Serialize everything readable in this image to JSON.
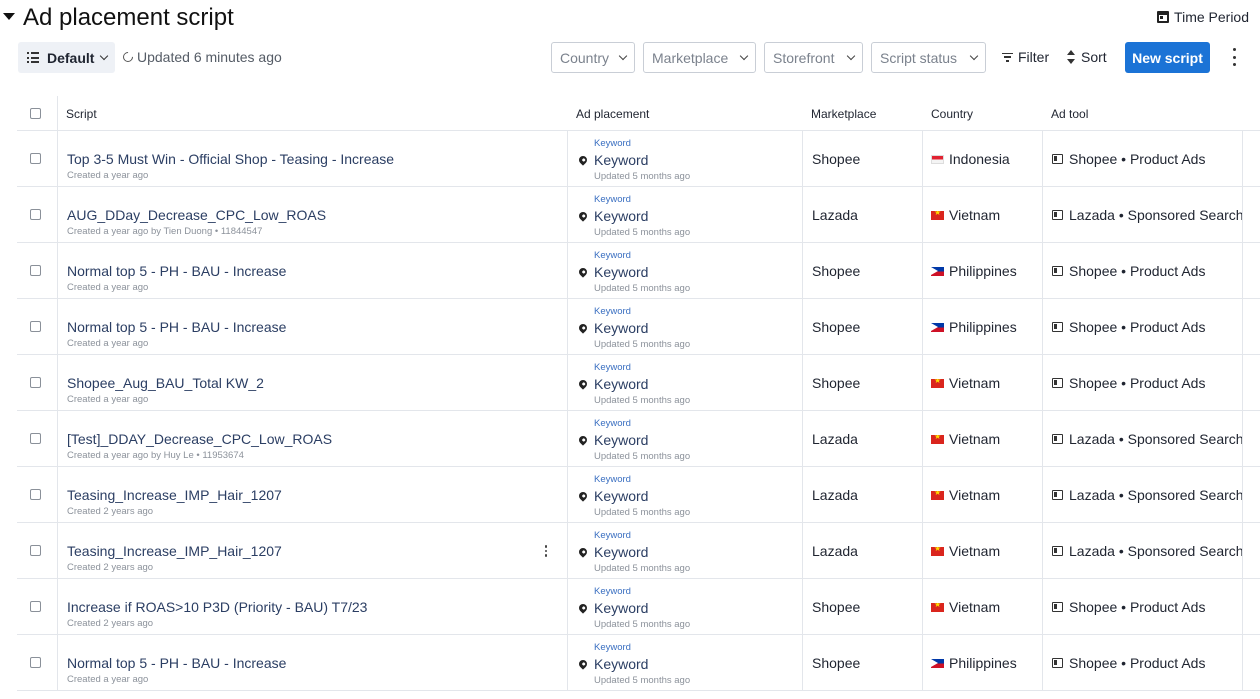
{
  "header": {
    "title": "Ad placement script",
    "time_period_label": "Time Period"
  },
  "toolbar": {
    "view_label": "Default",
    "updated_text": "Updated 6 minutes ago",
    "filters": {
      "country": "Country",
      "marketplace": "Marketplace",
      "storefront": "Storefront",
      "script_status": "Script status"
    },
    "filter_label": "Filter",
    "sort_label": "Sort",
    "new_script_label": "New script"
  },
  "table": {
    "columns": {
      "script": "Script",
      "ad_placement": "Ad placement",
      "marketplace": "Marketplace",
      "country": "Country",
      "ad_tool": "Ad tool"
    },
    "rows": [
      {
        "name": "Top 3-5 Must Win - Official Shop - Teasing - Increase",
        "meta": "Created a year ago",
        "placement_type": "Keyword",
        "placement": "Keyword",
        "placement_updated": "Updated 5 months ago",
        "marketplace": "Shopee",
        "country": "Indonesia",
        "flag": "id",
        "ad_tool": "Shopee • Product Ads",
        "show_menu": false
      },
      {
        "name": "AUG_DDay_Decrease_CPC_Low_ROAS",
        "meta": "Created a year ago by Tien Duong • 11844547",
        "placement_type": "Keyword",
        "placement": "Keyword",
        "placement_updated": "Updated 5 months ago",
        "marketplace": "Lazada",
        "country": "Vietnam",
        "flag": "vn",
        "ad_tool": "Lazada • Sponsored Search",
        "show_menu": false
      },
      {
        "name": "Normal top 5 - PH - BAU - Increase",
        "meta": "Created a year ago",
        "placement_type": "Keyword",
        "placement": "Keyword",
        "placement_updated": "Updated 5 months ago",
        "marketplace": "Shopee",
        "country": "Philippines",
        "flag": "ph",
        "ad_tool": "Shopee • Product Ads",
        "show_menu": false
      },
      {
        "name": "Normal top 5 - PH - BAU - Increase",
        "meta": "Created a year ago",
        "placement_type": "Keyword",
        "placement": "Keyword",
        "placement_updated": "Updated 5 months ago",
        "marketplace": "Shopee",
        "country": "Philippines",
        "flag": "ph",
        "ad_tool": "Shopee • Product Ads",
        "show_menu": false
      },
      {
        "name": "Shopee_Aug_BAU_Total KW_2",
        "meta": "Created a year ago",
        "placement_type": "Keyword",
        "placement": "Keyword",
        "placement_updated": "Updated 5 months ago",
        "marketplace": "Shopee",
        "country": "Vietnam",
        "flag": "vn",
        "ad_tool": "Shopee • Product Ads",
        "show_menu": false
      },
      {
        "name": "[Test]_DDAY_Decrease_CPC_Low_ROAS",
        "meta": "Created a year ago by Huy Le • 11953674",
        "placement_type": "Keyword",
        "placement": "Keyword",
        "placement_updated": "Updated 5 months ago",
        "marketplace": "Lazada",
        "country": "Vietnam",
        "flag": "vn",
        "ad_tool": "Lazada • Sponsored Search",
        "show_menu": false
      },
      {
        "name": "Teasing_Increase_IMP_Hair_1207",
        "meta": "Created 2 years ago",
        "placement_type": "Keyword",
        "placement": "Keyword",
        "placement_updated": "Updated 5 months ago",
        "marketplace": "Lazada",
        "country": "Vietnam",
        "flag": "vn",
        "ad_tool": "Lazada • Sponsored Search",
        "show_menu": false
      },
      {
        "name": "Teasing_Increase_IMP_Hair_1207",
        "meta": "Created 2 years ago",
        "placement_type": "Keyword",
        "placement": "Keyword",
        "placement_updated": "Updated 5 months ago",
        "marketplace": "Lazada",
        "country": "Vietnam",
        "flag": "vn",
        "ad_tool": "Lazada • Sponsored Search",
        "show_menu": true
      },
      {
        "name": "Increase if ROAS>10 P3D (Priority - BAU) T7/23",
        "meta": "Created 2 years ago",
        "placement_type": "Keyword",
        "placement": "Keyword",
        "placement_updated": "Updated 5 months ago",
        "marketplace": "Shopee",
        "country": "Vietnam",
        "flag": "vn",
        "ad_tool": "Shopee • Product Ads",
        "show_menu": false
      },
      {
        "name": "Normal top 5 - PH - BAU - Increase",
        "meta": "Created a year ago",
        "placement_type": "Keyword",
        "placement": "Keyword",
        "placement_updated": "Updated 5 months ago",
        "marketplace": "Shopee",
        "country": "Philippines",
        "flag": "ph",
        "ad_tool": "Shopee • Product Ads",
        "show_menu": false
      }
    ]
  },
  "colors": {
    "primary": "#1b73d6",
    "link": "#2b3e63",
    "muted": "#8c929b"
  }
}
